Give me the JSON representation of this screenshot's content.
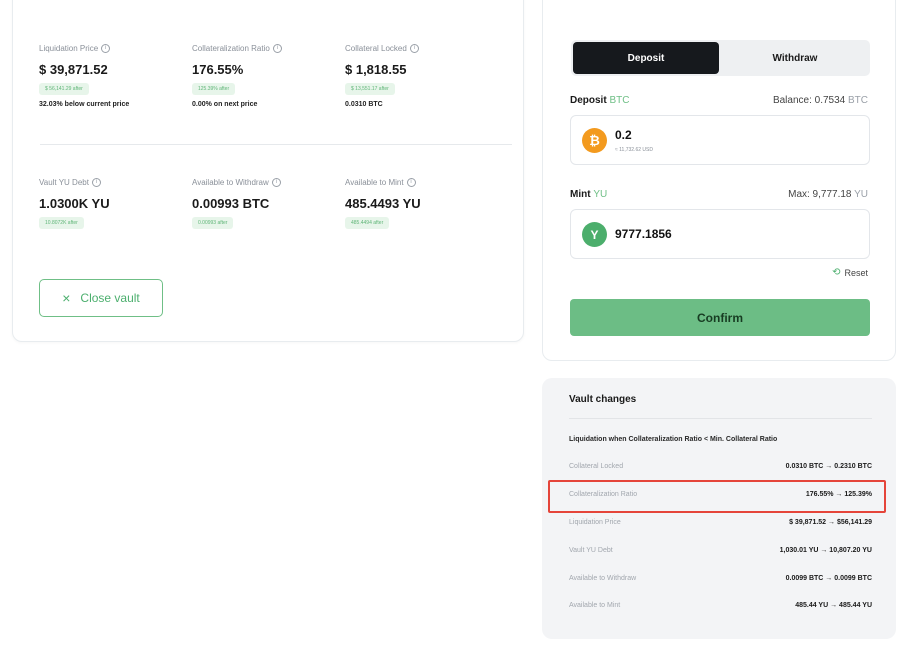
{
  "vault": {
    "stats_top": [
      {
        "label": "Liquidation Price",
        "value": "$ 39,871.52",
        "pill": "$ 56,141.29 after",
        "sub": "32.03% below current price"
      },
      {
        "label": "Collateralization Ratio",
        "value": "176.55%",
        "pill": "125.39% after",
        "sub": "0.00% on next price"
      },
      {
        "label": "Collateral Locked",
        "value": "$ 1,818.55",
        "pill": "$ 13,551.17 after",
        "sub": "0.0310 BTC"
      }
    ],
    "stats_bottom": [
      {
        "label": "Vault YU Debt",
        "value": "1.0300K YU",
        "pill": "10.8072K after"
      },
      {
        "label": "Available to Withdraw",
        "value": "0.00993 BTC",
        "pill": "0.00993 after"
      },
      {
        "label": "Available to Mint",
        "value": "485.4493 YU",
        "pill": "485.4494 after"
      }
    ],
    "info_glyph": "i",
    "close_button": {
      "icon": "×",
      "label": "Close vault"
    }
  },
  "deposit_panel": {
    "tabs": [
      {
        "label": "Deposit"
      },
      {
        "label": "Withdraw"
      }
    ],
    "active_tab": "Deposit",
    "deposit": {
      "label": "Deposit",
      "asset": "BTC",
      "balance_label": "Balance: 0.7534",
      "balance_asset": "BTC",
      "amount": "0.2",
      "fiat": "≈ 11,732.62 USD",
      "coin_glyph": "₿"
    },
    "mint": {
      "label": "Mint",
      "asset": "YU",
      "max_label": "Max: 9,777.18",
      "max_asset": "YU",
      "amount": "9777.1856",
      "coin_glyph": "Y"
    },
    "reset": {
      "icon": "⟲",
      "label": "Reset"
    },
    "confirm_label": "Confirm"
  },
  "vault_changes": {
    "title": "Vault changes",
    "note": "Liquidation when Collateralization Ratio < Min. Collateral Ratio",
    "rows": [
      {
        "label": "Collateral Locked",
        "value": "0.0310 BTC → 0.2310 BTC"
      },
      {
        "label": "Collateralization Ratio",
        "value": "176.55% → 125.39%"
      },
      {
        "label": "Liquidation Price",
        "value": "$ 39,871.52 → $56,141.29"
      },
      {
        "label": "Vault YU Debt",
        "value": "1,030.01 YU → 10,807.20 YU"
      },
      {
        "label": "Available to Withdraw",
        "value": "0.0099 BTC → 0.0099 BTC"
      },
      {
        "label": "Available to Mint",
        "value": "485.44 YU → 485.44 YU"
      }
    ],
    "highlighted_row": "Collateralization Ratio"
  },
  "colors": {
    "accent": "#6cbd85",
    "btc": "#f39a1e",
    "highlight": "#e5453a",
    "dark_tab": "#16191d"
  }
}
